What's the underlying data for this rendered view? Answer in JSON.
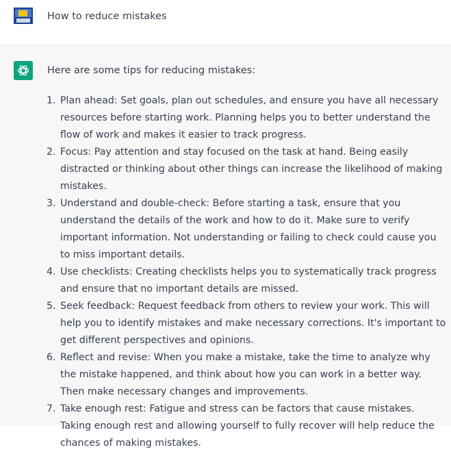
{
  "user": {
    "message": "How to reduce mistakes"
  },
  "assistant": {
    "intro": "Here are some tips for reducing mistakes:",
    "tips": [
      {
        "num": "1.",
        "text": "Plan ahead: Set goals, plan out schedules, and ensure you have all necessary resources before starting work. Planning helps you to better understand the flow of work and makes it easier to track progress."
      },
      {
        "num": "2.",
        "text": "Focus: Pay attention and stay focused on the task at hand. Being easily distracted or thinking about other things can increase the likelihood of making mistakes."
      },
      {
        "num": "3.",
        "text": "Understand and double-check: Before starting a task, ensure that you understand the details of the work and how to do it. Make sure to verify important information. Not understanding or failing to check could cause you to miss important details."
      },
      {
        "num": "4.",
        "text": "Use checklists: Creating checklists helps you to systematically track progress and ensure that no important details are missed."
      },
      {
        "num": "5.",
        "text": "Seek feedback: Request feedback from others to review your work. This will help you to identify mistakes and make necessary corrections. It's important to get different perspectives and opinions."
      },
      {
        "num": "6.",
        "text": "Reflect and revise: When you make a mistake, take the time to analyze why the mistake happened, and think about how you can work in a better way. Then make necessary changes and improvements."
      },
      {
        "num": "7.",
        "text": "Take enough rest: Fatigue and stress can be factors that cause mistakes. Taking enough rest and allowing yourself to fully recover will help reduce the chances of making mistakes."
      }
    ]
  },
  "icons": {
    "user_avatar": "user-avatar-image",
    "assistant_avatar": "openai-logo-icon"
  },
  "colors": {
    "assistant_avatar_bg": "#10a37f",
    "assistant_row_bg": "#f7f7f8",
    "text": "#374151"
  }
}
